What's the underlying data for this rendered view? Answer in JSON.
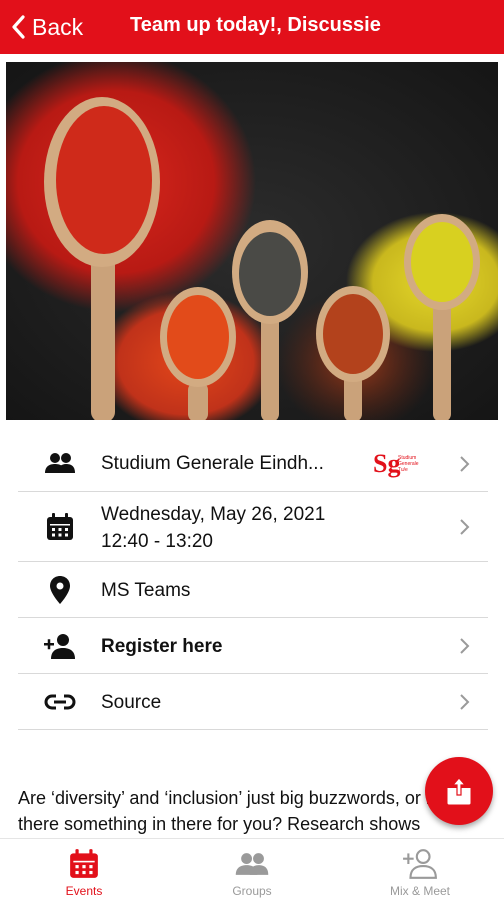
{
  "header": {
    "back_label": "Back",
    "title": "Team up today!, Discussie"
  },
  "details": {
    "organizer": "Studium Generale Eindh...",
    "organizer_logo_text": "Studium Generale Tu/e",
    "date": "Wednesday, May 26, 2021",
    "time": "12:40 - 13:20",
    "location": "MS Teams",
    "register": "Register here",
    "source": "Source"
  },
  "description": {
    "line1": "Are ‘diversity’ and ‘inclusion’ just big buzzwords, or is",
    "line2": "there something in there for you? Research shows"
  },
  "tabs": [
    {
      "label": "Events",
      "icon": "calendar-icon",
      "active": true
    },
    {
      "label": "Groups",
      "icon": "group-icon",
      "active": false
    },
    {
      "label": "Mix & Meet",
      "icon": "add-person-icon",
      "active": false
    }
  ],
  "colors": {
    "brand": "#e2101a",
    "inactive": "#9a9a9a"
  }
}
